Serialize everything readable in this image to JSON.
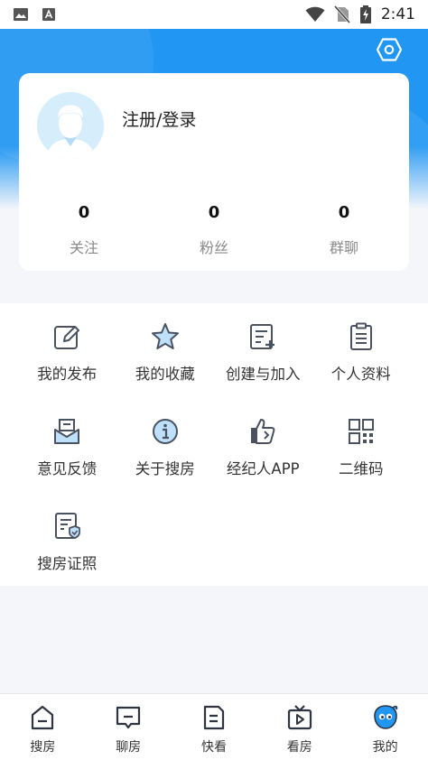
{
  "status_bar": {
    "time": "2:41",
    "icons": [
      "image-notification-icon",
      "text-notification-icon",
      "wifi-icon",
      "no-sim-icon",
      "battery-charging-icon"
    ]
  },
  "header": {
    "settings_icon": "settings-hexagon-icon",
    "accent_color": "#2196f3"
  },
  "profile": {
    "login_label": "注册/登录",
    "avatar_icon": "default-avatar-icon",
    "stats": [
      {
        "value": "0",
        "label": "关注"
      },
      {
        "value": "0",
        "label": "粉丝"
      },
      {
        "value": "0",
        "label": "群聊"
      }
    ]
  },
  "menu": {
    "items": [
      {
        "label": "我的发布",
        "icon": "edit-icon"
      },
      {
        "label": "我的收藏",
        "icon": "star-icon"
      },
      {
        "label": "创建与加入",
        "icon": "create-join-icon"
      },
      {
        "label": "个人资料",
        "icon": "clipboard-icon"
      },
      {
        "label": "意见反馈",
        "icon": "feedback-mail-icon"
      },
      {
        "label": "关于搜房",
        "icon": "info-icon"
      },
      {
        "label": "经纪人APP",
        "icon": "agent-app-icon"
      },
      {
        "label": "二维码",
        "icon": "qr-code-icon"
      },
      {
        "label": "搜房证照",
        "icon": "license-icon"
      }
    ]
  },
  "tabbar": {
    "tabs": [
      {
        "label": "搜房",
        "icon": "search-house-icon",
        "active": false
      },
      {
        "label": "聊房",
        "icon": "chat-icon",
        "active": false
      },
      {
        "label": "快看",
        "icon": "document-icon",
        "active": false
      },
      {
        "label": "看房",
        "icon": "video-icon",
        "active": false
      },
      {
        "label": "我的",
        "icon": "mascot-icon",
        "active": true
      }
    ]
  }
}
